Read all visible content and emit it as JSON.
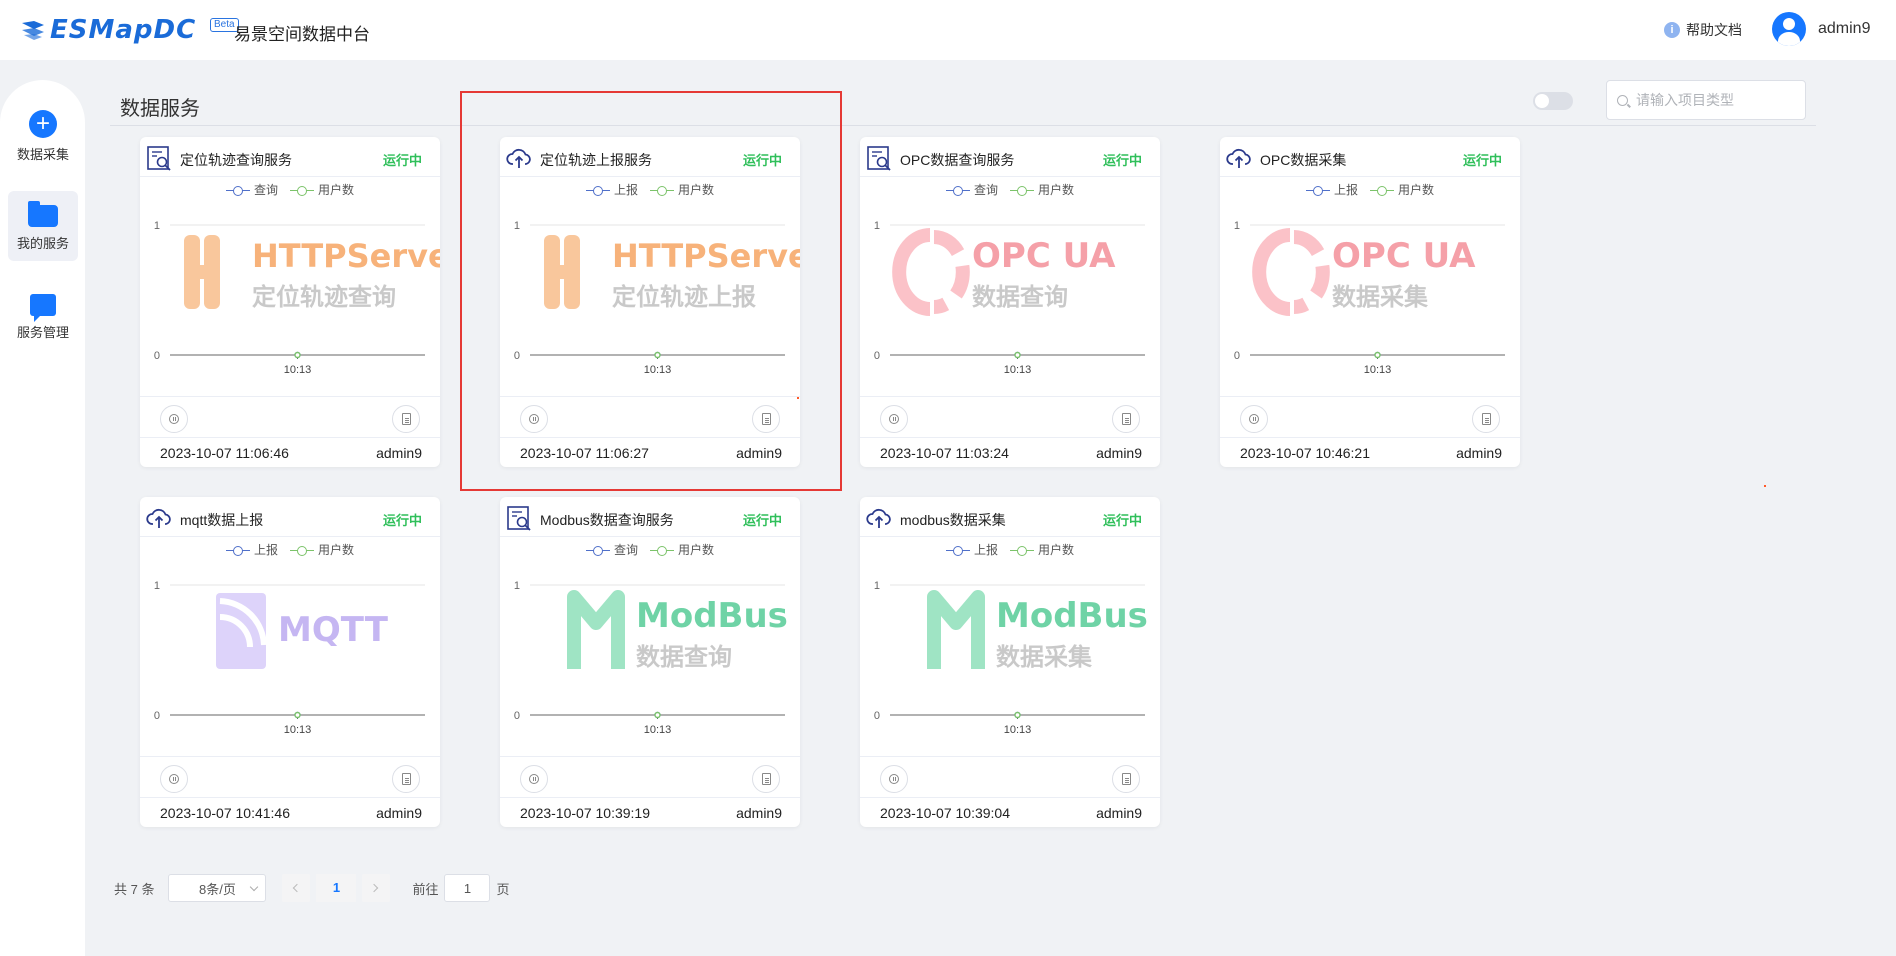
{
  "app": {
    "logo_text": "ESMapDC",
    "beta": "Beta",
    "title": "易景空间数据中台"
  },
  "header": {
    "help": "帮助文档",
    "help_icon_text": "i",
    "user": "admin9"
  },
  "sidebar": {
    "items": [
      {
        "label": "数据采集",
        "icon": "plus-circle-icon",
        "plus": "+"
      },
      {
        "label": "我的服务",
        "icon": "folder-icon"
      },
      {
        "label": "服务管理",
        "icon": "chat-icon"
      }
    ]
  },
  "page": {
    "title": "数据服务",
    "search_placeholder": "请输入项目类型"
  },
  "colors": {
    "accent": "#1677ff",
    "status": "#2fbf5a",
    "series_blue": "#4f6fc9",
    "series_green": "#7cc36a",
    "highlight": "#e53935"
  },
  "cards": [
    {
      "title": "定位轨迹查询服务",
      "status": "运行中",
      "icon": "query-icon",
      "legend": [
        "查询",
        "用户数"
      ],
      "time": "2023-10-07 11:06:46",
      "user": "admin9",
      "wm_type": "http",
      "wm_title": "HTTPServer",
      "wm_sub": "定位轨迹查询"
    },
    {
      "title": "定位轨迹上报服务",
      "status": "运行中",
      "icon": "upload-cloud-icon",
      "legend": [
        "上报",
        "用户数"
      ],
      "time": "2023-10-07 11:06:27",
      "user": "admin9",
      "wm_type": "http",
      "wm_title": "HTTPServer",
      "wm_sub": "定位轨迹上报"
    },
    {
      "title": "OPC数据查询服务",
      "status": "运行中",
      "icon": "query-icon",
      "legend": [
        "查询",
        "用户数"
      ],
      "time": "2023-10-07 11:03:24",
      "user": "admin9",
      "wm_type": "opc",
      "wm_title": "OPC UA",
      "wm_sub": "数据查询"
    },
    {
      "title": "OPC数据采集",
      "status": "运行中",
      "icon": "upload-cloud-icon",
      "legend": [
        "上报",
        "用户数"
      ],
      "time": "2023-10-07 10:46:21",
      "user": "admin9",
      "wm_type": "opc",
      "wm_title": "OPC UA",
      "wm_sub": "数据采集"
    },
    {
      "title": "mqtt数据上报",
      "status": "运行中",
      "icon": "upload-cloud-icon",
      "legend": [
        "上报",
        "用户数"
      ],
      "time": "2023-10-07 10:41:46",
      "user": "admin9",
      "wm_type": "mqtt",
      "wm_title": "MQTT",
      "wm_sub": ""
    },
    {
      "title": "Modbus数据查询服务",
      "status": "运行中",
      "icon": "query-icon",
      "legend": [
        "查询",
        "用户数"
      ],
      "time": "2023-10-07 10:39:19",
      "user": "admin9",
      "wm_type": "modbus",
      "wm_title": "ModBus",
      "wm_sub": "数据查询"
    },
    {
      "title": "modbus数据采集",
      "status": "运行中",
      "icon": "upload-cloud-icon",
      "legend": [
        "上报",
        "用户数"
      ],
      "time": "2023-10-07 10:39:04",
      "user": "admin9",
      "wm_type": "modbus",
      "wm_title": "ModBus",
      "wm_sub": "数据采集"
    }
  ],
  "chart_data": {
    "type": "line",
    "x": [
      "10:13"
    ],
    "ylim": [
      0,
      1
    ],
    "y_ticks": [
      "1",
      "0"
    ],
    "series": [
      {
        "name": "查询/上报",
        "values": [
          0
        ]
      },
      {
        "name": "用户数",
        "values": [
          0
        ]
      }
    ]
  },
  "pagination": {
    "total": "共 7 条",
    "page_size": "8条/页",
    "current": "1",
    "goto_label": "前往",
    "goto_value": "1",
    "page_suffix": "页"
  }
}
